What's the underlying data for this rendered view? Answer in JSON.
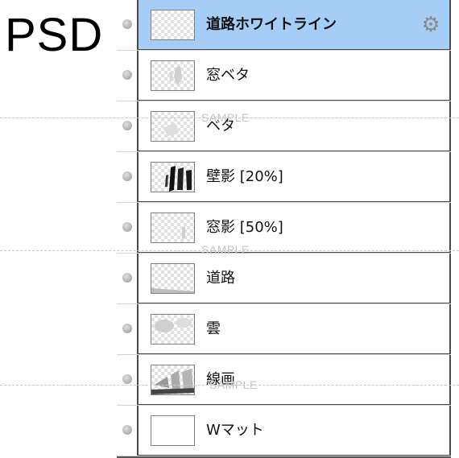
{
  "badge": "PSD",
  "layers": [
    {
      "name": "道路ホワイトライン",
      "selected": true,
      "thumb": "checker",
      "icon": "gear-icon"
    },
    {
      "name": "窓ベタ",
      "selected": false,
      "thumb": "checker"
    },
    {
      "name": "ベタ",
      "selected": false,
      "thumb": "checker"
    },
    {
      "name": "壁影 [20%]",
      "selected": false,
      "thumb": "checker"
    },
    {
      "name": "窓影 [50%]",
      "selected": false,
      "thumb": "checker"
    },
    {
      "name": "道路",
      "selected": false,
      "thumb": "checker"
    },
    {
      "name": "雲",
      "selected": false,
      "thumb": "checker"
    },
    {
      "name": "線画",
      "selected": false,
      "thumb": "checker"
    },
    {
      "name": "Wマット",
      "selected": false,
      "thumb": "plain"
    }
  ],
  "watermark": "SAMPLE",
  "colors": {
    "selected_row": "#a6cdf6",
    "border": "#4a4a4a"
  }
}
